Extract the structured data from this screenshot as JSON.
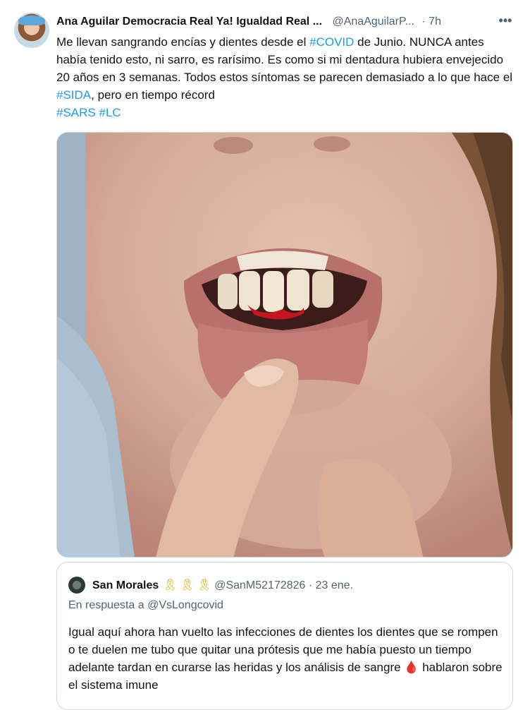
{
  "tweet": {
    "author_name": "Ana Aguilar Democracia Real Ya! Igualdad Real ...",
    "author_handle": "@AnaAguilarP...",
    "time": "· 7h",
    "more_icon": "more-dots-icon",
    "text_1": "Me llevan sangrando encías y dientes desde el ",
    "tag_covid": "#COVID",
    "text_2": " de Junio. NUNCA antes había tenido esto, ni sarro, es rarísimo. Es como si mi dentadura hubiera envejecido 20 años en 3 semanas. Todos estos síntomas se parecen demasiado a lo que hace el ",
    "tag_sida": "#SIDA",
    "text_3": ", pero en tiempo récord",
    "tag_sars": "#SARS",
    "tag_lc": "#LC"
  },
  "quote": {
    "author_name": "San Morales",
    "ribbons": "🎗🎗🎗",
    "author_handle": "@SanM52172826 · 23 ene.",
    "reply_prefix": "En respuesta a ",
    "reply_mention": "@VsLongcovid",
    "text": "Igual aquí ahora han vuelto las infecciones de dientes los dientes que se rompen o te duelen me tubo que quitar una prótesis que me había puesto un tiempo adelante tardan en curarse las heridas y los análisis de sangre ",
    "drop": "🩸",
    "text_end": " hablaron sobre el sistema imune"
  },
  "colors": {
    "link": "#1d9bf0",
    "secondary": "#536471",
    "border": "#cfd9de"
  }
}
